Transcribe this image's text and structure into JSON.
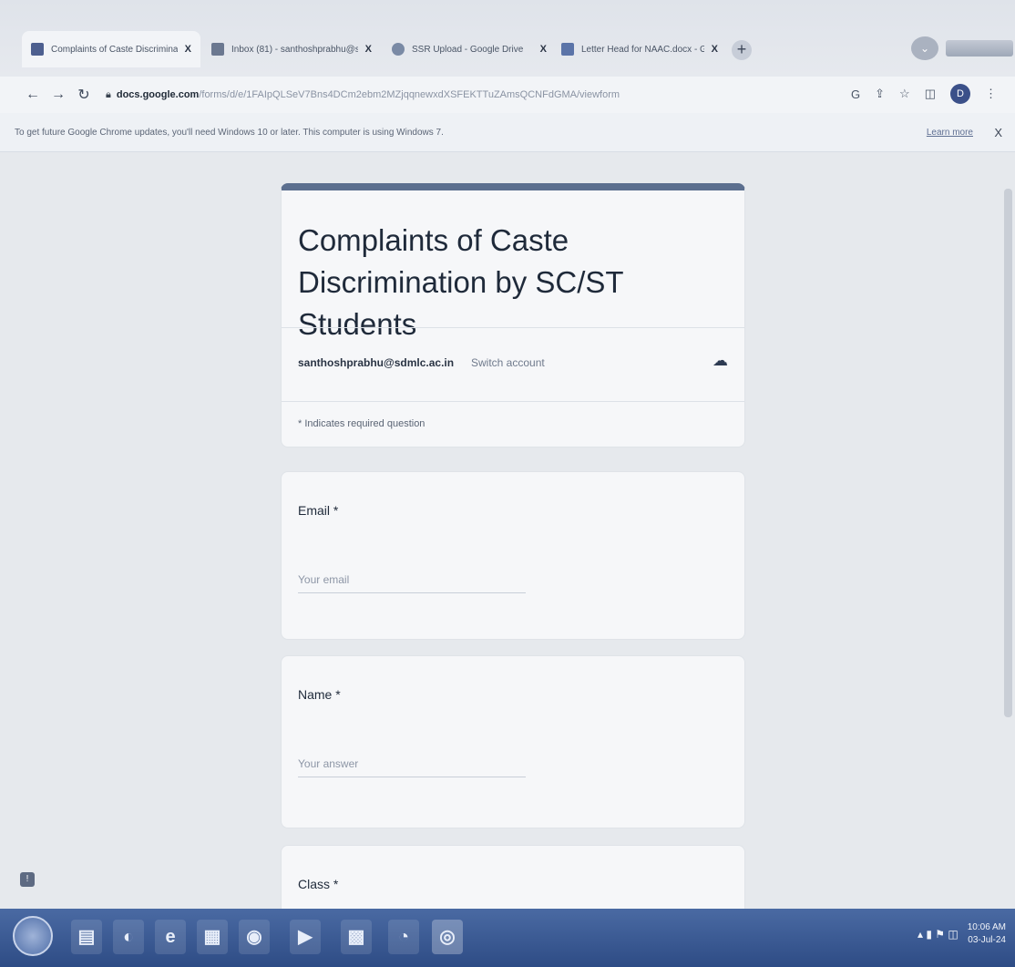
{
  "browser": {
    "tabs": [
      {
        "label": "Complaints of Caste Discriminati",
        "close": "X",
        "icon": "google-forms-icon"
      },
      {
        "label": "Inbox (81) - santhoshprabhu@s",
        "close": "X",
        "icon": "gmail-icon"
      },
      {
        "label": "SSR Upload - Google Drive",
        "close": "X",
        "icon": "google-drive-icon"
      },
      {
        "label": "Letter Head for NAAC.docx - Go",
        "close": "X",
        "icon": "google-docs-icon"
      }
    ],
    "new_tab": "+",
    "url_host": "docs.google.com",
    "url_path": "/forms/d/e/1FAIpQLSeV7Bns4DCm2ebm2MZjqqnewxdXSFEKTTuZAmsQCNFdGMA/viewform",
    "profile_initial": "D",
    "toolbar_icons": [
      "G",
      "⇪",
      "☆",
      "◫"
    ],
    "infobar": {
      "message": "To get future Google Chrome updates, you'll need Windows 10 or later. This computer is using Windows 7.",
      "learn_more": "Learn more",
      "close": "X"
    }
  },
  "form": {
    "title": "Complaints of Caste Discrimination by SC/ST Students",
    "account_email": "santhoshprabhu@sdmlc.ac.in",
    "switch_account": "Switch account",
    "required_note": "* Indicates required question",
    "questions": [
      {
        "label": "Email",
        "required_mark": "*",
        "placeholder": "Your email"
      },
      {
        "label": "Name",
        "required_mark": "*",
        "placeholder": "Your answer"
      },
      {
        "label": "Class",
        "required_mark": "*"
      }
    ]
  },
  "taskbar": {
    "time": "10:06 AM",
    "date": "03-Jul-24"
  }
}
